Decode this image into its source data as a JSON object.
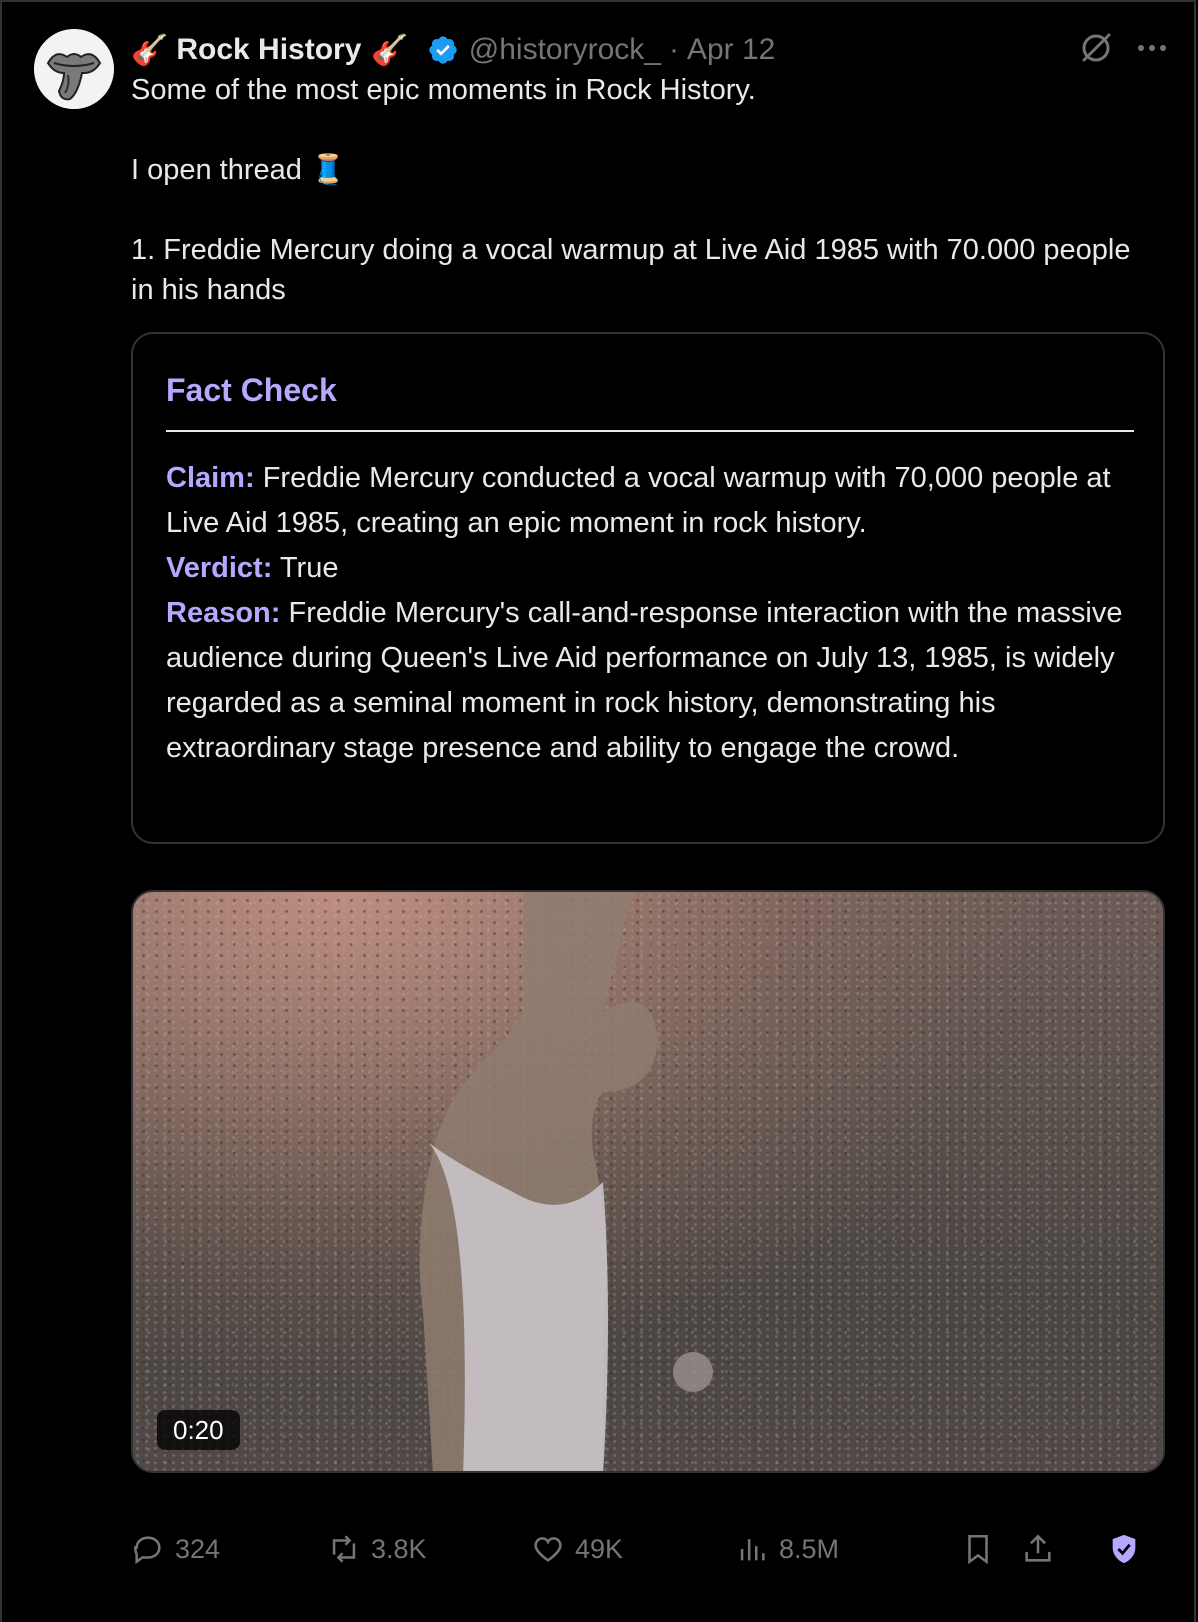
{
  "tweet": {
    "author_emoji_left": "🎸",
    "author_name": "Rock History",
    "author_emoji_right": "🎸",
    "handle": "@historyrock_",
    "separator": "·",
    "date": "Apr 12",
    "text_line1": "Some of the most epic moments in Rock History.",
    "text_line2": "I open thread 🧵",
    "text_line3": "1. Freddie Mercury doing a vocal warmup at Live Aid 1985 with 70.000 people in his hands"
  },
  "fact_check": {
    "title": "Fact Check",
    "claim_label": "Claim:",
    "claim_text": "Freddie Mercury conducted a vocal warmup with 70,000 people at Live Aid 1985, creating an epic moment in rock history.",
    "verdict_label": "Verdict:",
    "verdict_text": "True",
    "reason_label": "Reason:",
    "reason_text": "Freddie Mercury's call-and-response interaction with the massive audience during Queen's Live Aid performance on July 13, 1985, is widely regarded as a seminal moment in rock history, demonstrating his extraordinary stage presence and ability to engage the crowd."
  },
  "video": {
    "duration": "0:20"
  },
  "actions": {
    "replies": "324",
    "reposts": "3.8K",
    "likes": "49K",
    "views": "8.5M"
  },
  "icons": {
    "verified": "verified-badge-icon",
    "grok": "grok-icon",
    "more": "more-icon",
    "reply": "reply-icon",
    "repost": "repost-icon",
    "like": "heart-icon",
    "views": "views-chart-icon",
    "bookmark": "bookmark-icon",
    "share": "share-icon",
    "shield": "shield-check-icon"
  },
  "colors": {
    "accent": "#b4a9ff",
    "verified": "#1d9bf0",
    "muted": "#71767b"
  }
}
